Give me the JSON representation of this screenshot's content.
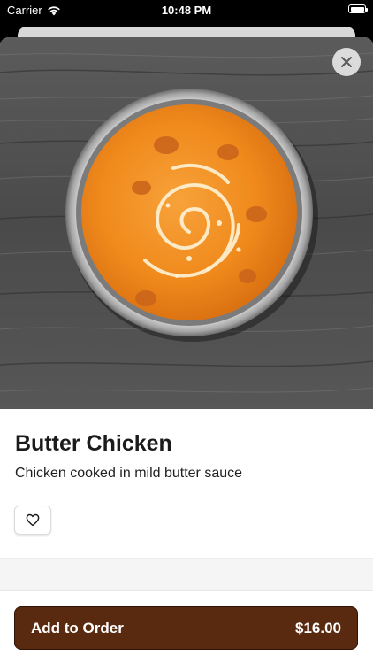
{
  "status_bar": {
    "carrier": "Carrier",
    "time": "10:48 PM"
  },
  "item": {
    "name": "Butter Chicken",
    "description": "Chicken cooked in mild butter sauce",
    "image_subject": "bowl of butter chicken on wooden table"
  },
  "actions": {
    "add_to_order_label": "Add to Order",
    "price": "$16.00"
  },
  "icons": {
    "close": "close-icon",
    "favorite": "heart-icon",
    "wifi": "wifi-icon",
    "battery": "battery-icon"
  },
  "colors": {
    "accent": "#5a2a10",
    "curry": "#f08a1c"
  }
}
